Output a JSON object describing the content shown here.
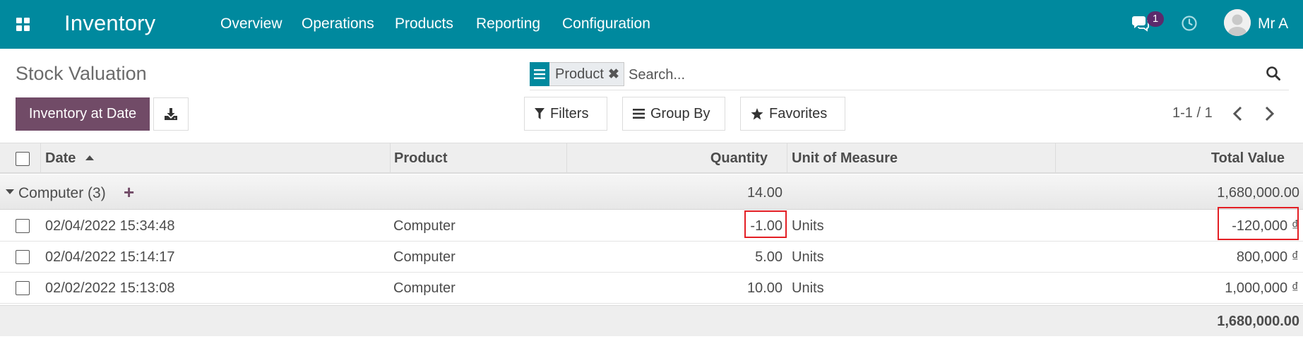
{
  "navbar": {
    "app_name": "Inventory",
    "menu": [
      "Overview",
      "Operations",
      "Products",
      "Reporting",
      "Configuration"
    ],
    "chat_badge": "1",
    "user_name": "Mr A",
    "color": "#00899e"
  },
  "control_panel": {
    "title": "Stock Valuation",
    "primary_button": "Inventory at Date",
    "facet_label": "Product",
    "search_placeholder": "Search...",
    "filters_label": "Filters",
    "groupby_label": "Group By",
    "favorites_label": "Favorites",
    "pager": "1-1 / 1",
    "accent_color": "#714b67"
  },
  "table": {
    "columns": [
      "Date",
      "Product",
      "Quantity",
      "Unit of Measure",
      "Total Value"
    ],
    "group": {
      "label": "Computer (3)",
      "quantity": "14.00",
      "total": "1,680,000.00"
    },
    "rows": [
      {
        "date": "02/04/2022 15:34:48",
        "product": "Computer",
        "quantity": "-1.00",
        "uom": "Units",
        "total": "-120,000 ₫"
      },
      {
        "date": "02/04/2022 15:14:17",
        "product": "Computer",
        "quantity": "5.00",
        "uom": "Units",
        "total": "800,000 ₫"
      },
      {
        "date": "02/02/2022 15:13:08",
        "product": "Computer",
        "quantity": "10.00",
        "uom": "Units",
        "total": "1,000,000 ₫"
      }
    ],
    "footer_total": "1,680,000.00",
    "highlight_color": "#e31e24"
  }
}
